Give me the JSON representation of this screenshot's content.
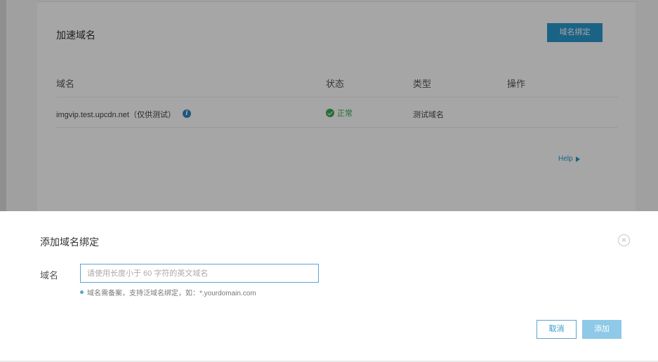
{
  "page": {
    "title": "加速域名",
    "bind_button": "域名绑定",
    "table": {
      "headers": [
        "域名",
        "状态",
        "类型",
        "操作"
      ],
      "rows": [
        {
          "domain": "imgvip.test.upcdn.net（仅供测试）",
          "status": "正常",
          "type": "测试域名",
          "actions": ""
        }
      ]
    },
    "help_link": "Help"
  },
  "dialog": {
    "title": "添加域名绑定",
    "field_label": "域名",
    "input_value": "",
    "input_placeholder": "请使用长度小于 60 字符的英文域名",
    "hint": "域名需备案，支持泛域名绑定，如：*.yourdomain.com",
    "cancel_label": "取消",
    "add_label": "添加",
    "close_symbol": "×"
  },
  "icons": {
    "info": "info-icon",
    "status_ok": "check-circle-icon",
    "help_arrow": "play-arrow-icon",
    "close": "close-circle-icon"
  },
  "colors": {
    "accent": "#2a98cd",
    "status_ok": "#3aa955",
    "add_button_disabled": "#8ec9e8",
    "overlay": "rgba(0,0,0,0.35)"
  }
}
